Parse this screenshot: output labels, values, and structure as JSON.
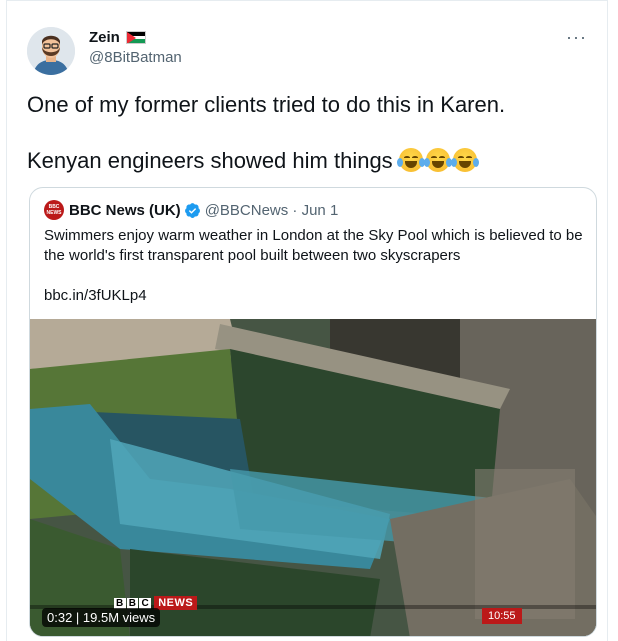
{
  "author": {
    "display_name": "Zein",
    "handle": "@8BitBatman",
    "avatar_icon": "bearded-man-avatar",
    "flag_icon": "palestine-flag-icon"
  },
  "more_icon": "more-horizontal-icon",
  "tweet": {
    "line1": "One of my former clients tried to do this in Karen.",
    "line2": "Kenyan engineers showed him things",
    "emojis": [
      "face-with-tears-of-joy-icon",
      "face-with-tears-of-joy-icon",
      "face-with-tears-of-joy-icon"
    ]
  },
  "quoted_tweet": {
    "logo_icon": "bbc-news-logo",
    "display_name": "BBC News (UK)",
    "verified_icon": "verified-badge-icon",
    "handle_date": "@BBCNews · Jun 1",
    "text": "Swimmers enjoy warm weather in London at the Sky Pool which is believed to be the world's first transparent pool built between two skyscrapers",
    "link": "bbc.in/3fUKLp4",
    "video": {
      "duration_views": "0:32 | 19.5M views",
      "channel_bug": "NEWS",
      "clock": "10:55"
    }
  },
  "colors": {
    "text": "#0f1419",
    "secondary": "#536471",
    "border": "#cfd9de",
    "verified": "#1d9bf0",
    "bbc_red": "#bb1919"
  }
}
